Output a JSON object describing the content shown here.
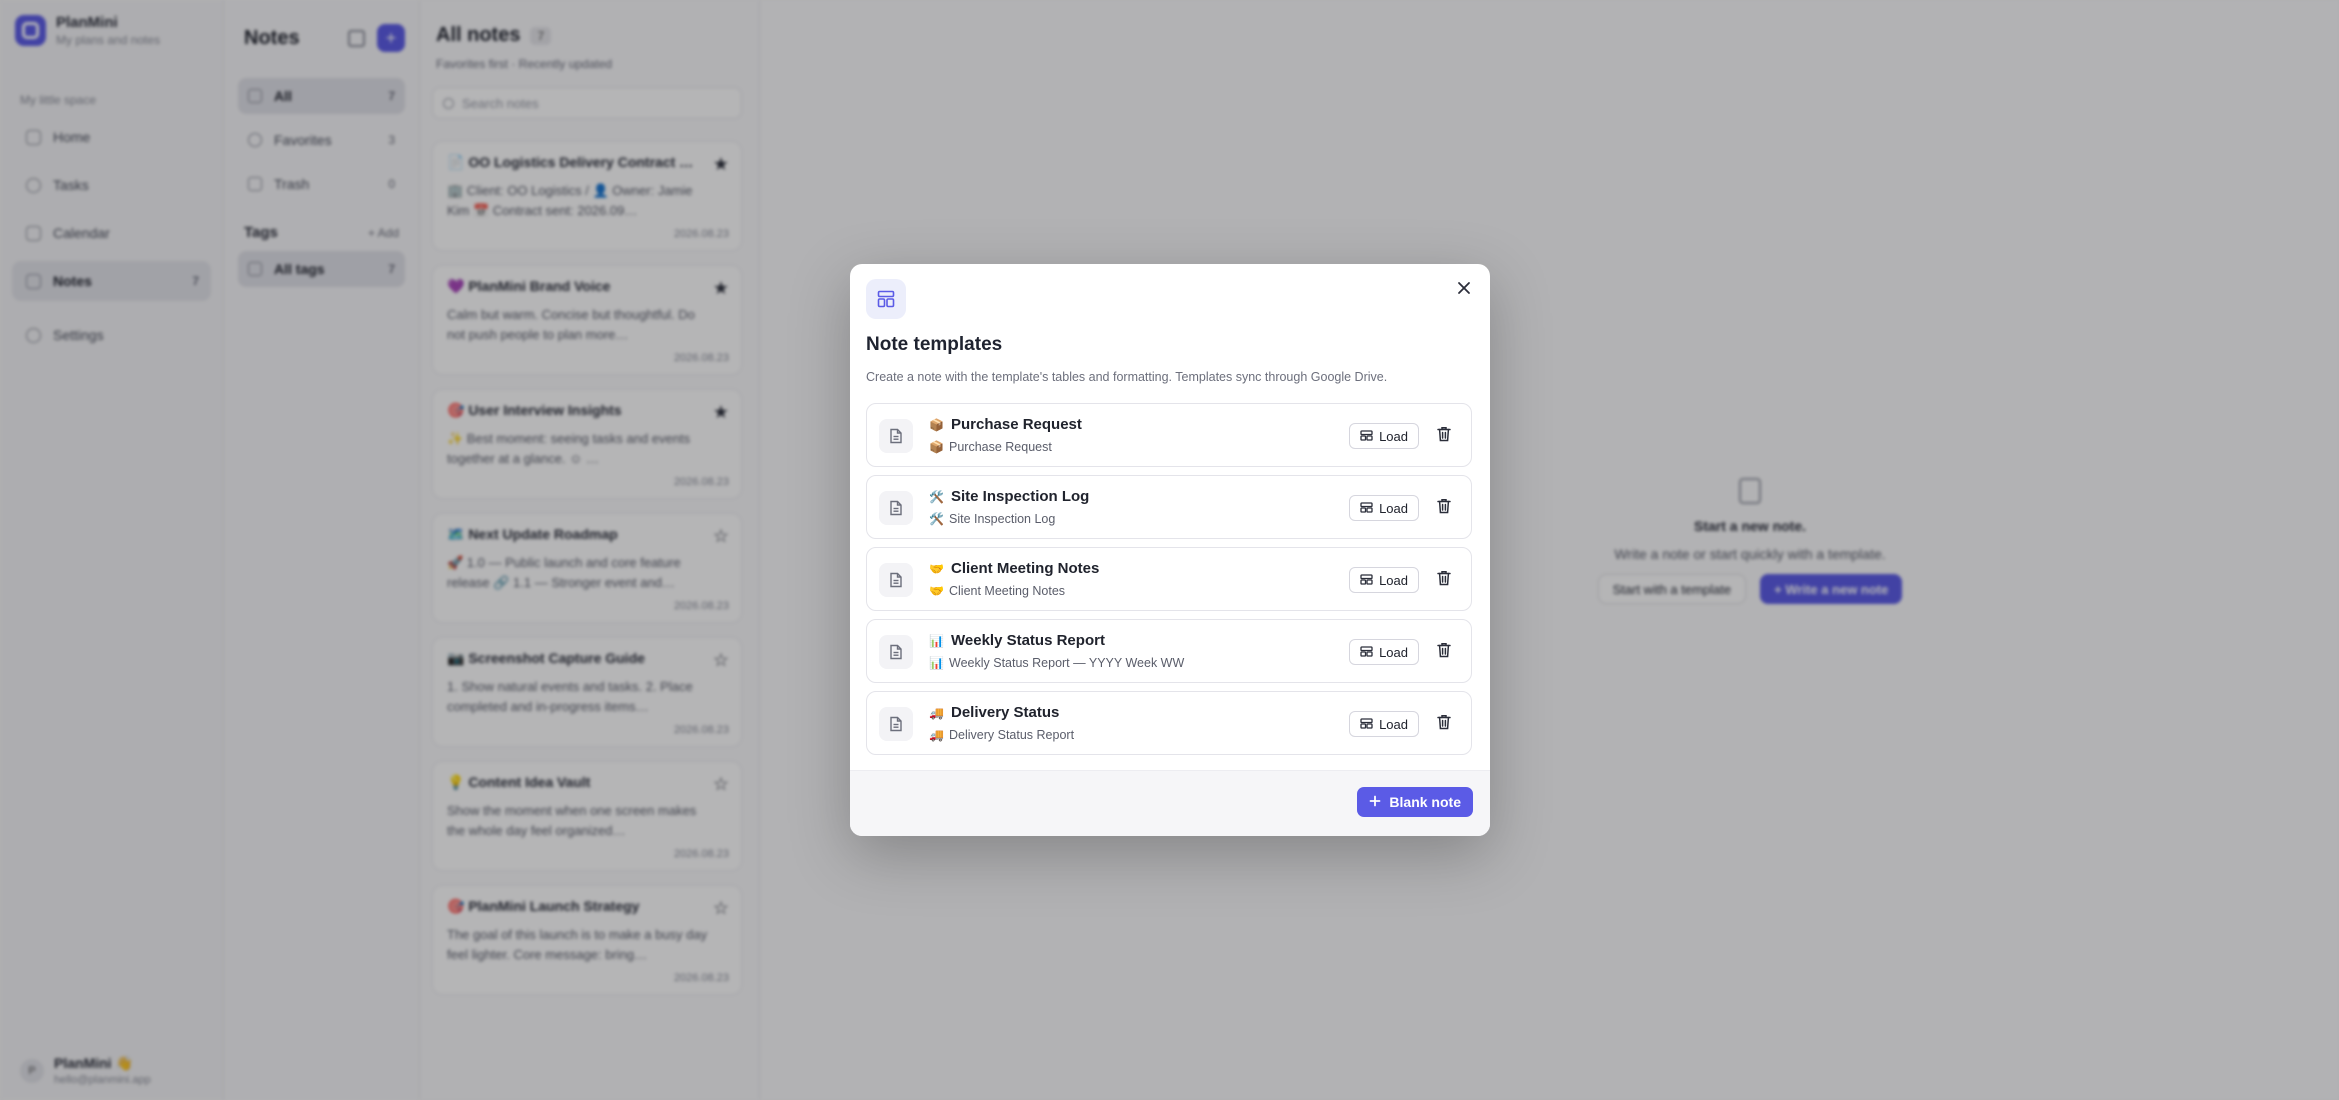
{
  "app": {
    "name": "PlanMini",
    "tagline": "My plans and notes"
  },
  "sidebar": {
    "space_label": "My little space",
    "items": [
      {
        "label": "Home",
        "icon": "home-icon"
      },
      {
        "label": "Tasks",
        "icon": "check-circle-icon"
      },
      {
        "label": "Calendar",
        "icon": "calendar-icon"
      },
      {
        "label": "Notes",
        "icon": "notes-icon",
        "count": "7",
        "active": true
      },
      {
        "label": "Settings",
        "icon": "gear-icon"
      }
    ],
    "user": {
      "avatar": "P",
      "name": "PlanMini 👋",
      "email": "hello@planmini.app"
    }
  },
  "notes_panel": {
    "title": "Notes",
    "filters": [
      {
        "label": "All",
        "count": "7"
      },
      {
        "label": "Favorites",
        "count": "3"
      },
      {
        "label": "Trash",
        "count": "0"
      }
    ],
    "tags_title": "Tags",
    "tags_add": "+ Add",
    "tag_all": {
      "label": "All tags",
      "count": "7"
    }
  },
  "list": {
    "title": "All notes",
    "count": "7",
    "subtitle": "Favorites first · Recently updated",
    "search_placeholder": "Search notes",
    "notes": [
      {
        "title": "📄 OO Logistics Delivery Contract Pro…",
        "body": "🏢 Client: OO Logistics / 👤 Owner: Jamie Kim 📅 Contract sent: 2026.09…",
        "date": "2026.08.23",
        "star": "★"
      },
      {
        "title": "💜 PlanMini Brand Voice",
        "body": "Calm but warm. Concise but thoughtful. Do not push people to plan more…",
        "date": "2026.08.23",
        "star": "★"
      },
      {
        "title": "🎯 User Interview Insights",
        "body": "✨ Best moment: seeing tasks and events together at a glance. ☺ …",
        "date": "2026.08.23",
        "star": "★"
      },
      {
        "title": "🗺️ Next Update Roadmap",
        "body": "🚀 1.0 — Public launch and core feature release 🔗 1.1 — Stronger event and…",
        "date": "2026.08.23",
        "star": "☆"
      },
      {
        "title": "📷 Screenshot Capture Guide",
        "body": "1. Show natural events and tasks. 2. Place completed and in-progress items…",
        "date": "2026.08.23",
        "star": "☆"
      },
      {
        "title": "💡 Content Idea Vault",
        "body": "Show the moment when one screen makes the whole day feel organized…",
        "date": "2026.08.23",
        "star": "☆"
      },
      {
        "title": "🎯 PlanMini Launch Strategy",
        "body": "The goal of this launch is to make a busy day feel lighter. Core message: bring…",
        "date": "2026.08.23",
        "star": "☆"
      }
    ]
  },
  "empty_state": {
    "title": "Start a new note.",
    "subtitle": "Write a note or start quickly with a template.",
    "template_button": "Start with a template",
    "write_button": "+ Write a new note"
  },
  "modal": {
    "title": "Note templates",
    "description": "Create a note with the template's tables and formatting. Templates sync through Google Drive.",
    "load_label": "Load",
    "blank_label": "Blank note",
    "templates": [
      {
        "emoji": "📦",
        "name": "Purchase Request",
        "sub": "Purchase Request"
      },
      {
        "emoji": "🛠️",
        "name": "Site Inspection Log",
        "sub": "Site Inspection Log"
      },
      {
        "emoji": "🤝",
        "name": "Client Meeting Notes",
        "sub": "Client Meeting Notes"
      },
      {
        "emoji": "📊",
        "name": "Weekly Status Report",
        "sub": "Weekly Status Report — YYYY Week WW"
      },
      {
        "emoji": "🚚",
        "name": "Delivery Status",
        "sub": "Delivery Status Report"
      }
    ]
  },
  "colors": {
    "accent": "#5b5be6",
    "overlay": "rgba(10,10,14,0.30)"
  }
}
